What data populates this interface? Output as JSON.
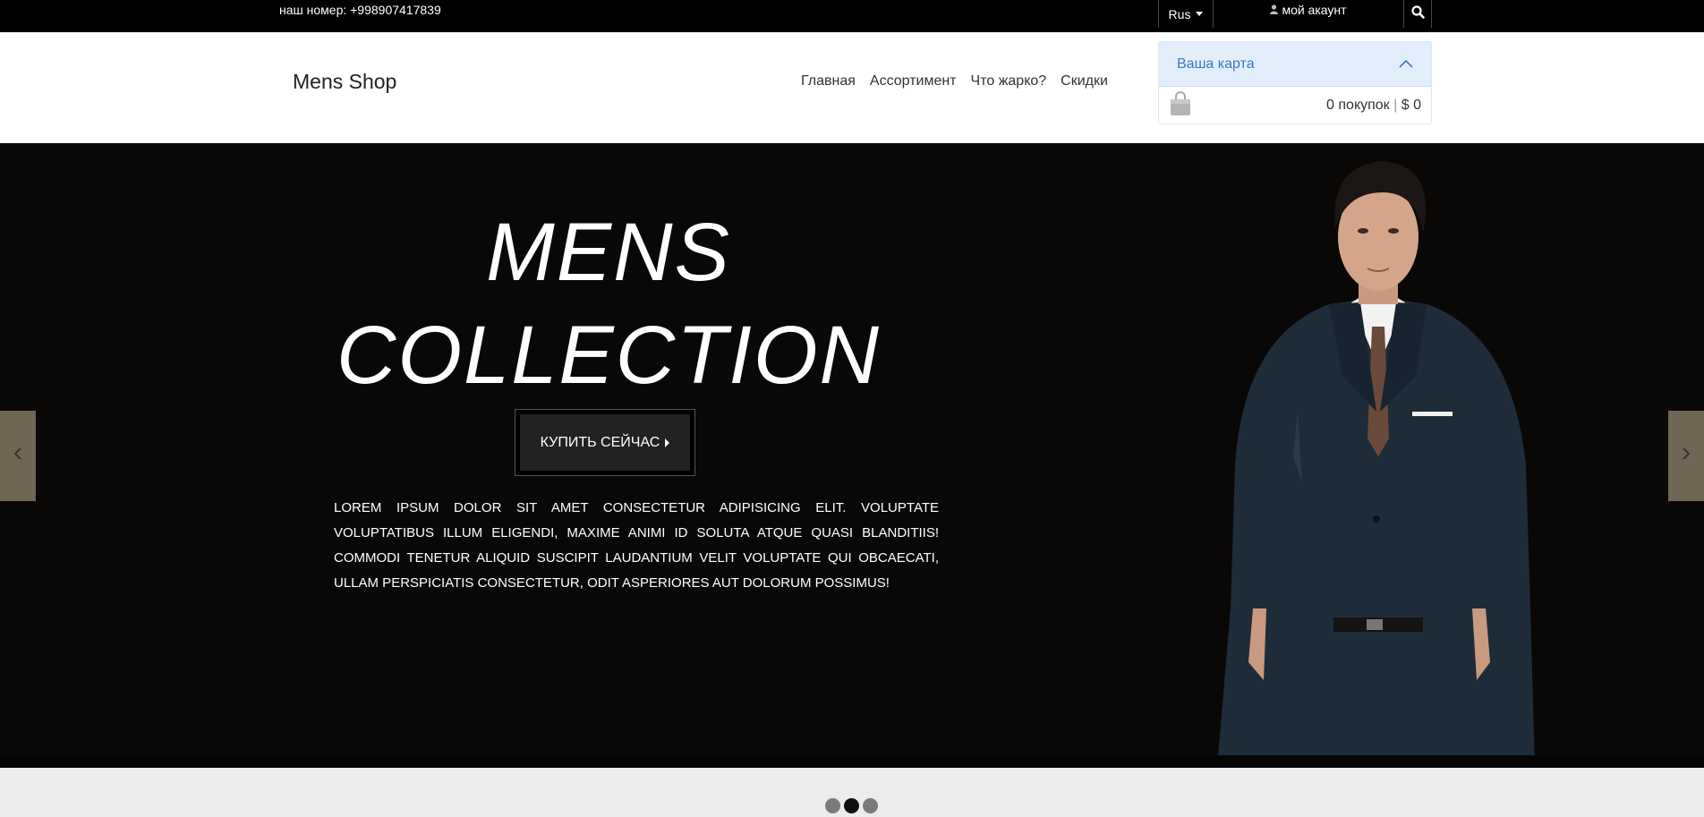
{
  "topbar": {
    "phone": "наш номер: +998907417839",
    "language": "Rus",
    "account": "мой акаунт"
  },
  "header": {
    "brand": "Mens Shop",
    "nav": [
      "Главная",
      "Ассортимент",
      "Что жарко?",
      "Скидки"
    ]
  },
  "cart": {
    "title": "Ваша карта",
    "items": "0 покупок",
    "separator": "|",
    "total": "$ 0"
  },
  "hero": {
    "title_line1": "MENS",
    "title_line2": "COLLECTION",
    "button": "КУПИТЬ СЕЙЧАС",
    "description": "LOREM IPSUM DOLOR SIT AMET CONSECTETUR ADIPISICING ELIT. VOLUPTATE VOLUPTATIBUS ILLUM ELIGENDI, MAXIME ANIMI ID SOLUTA ATQUE QUASI BLANDITIIS! COMMODI TENETUR ALIQUID SUSCIPIT LAUDANTIUM VELIT VOLUPTATE QUI OBCAECATI, ULLAM PERSPICIATIS CONSECTETUR, ODIT ASPERIORES AUT DOLORUM POSSIMUS!"
  },
  "carousel": {
    "slides": 3,
    "active_slide": 2
  },
  "colors": {
    "topbar": "#000000",
    "hero_bg": "#0a0807",
    "cart_header": "#e3eefb",
    "cart_title": "#3a78c3",
    "arrow_bg": "#6f6656"
  },
  "icons": [
    "user-icon",
    "search-icon",
    "chevron-up-icon",
    "shopping-bag-icon",
    "caret-right-icon",
    "chevron-left-icon",
    "chevron-right-icon"
  ]
}
